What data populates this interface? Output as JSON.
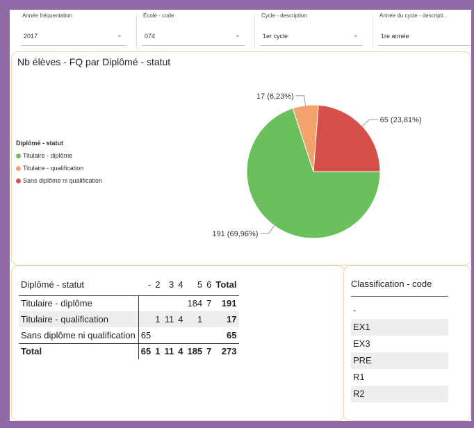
{
  "filters": [
    {
      "label": "Année fréquentation",
      "value": "2017"
    },
    {
      "label": "École - code",
      "value": "074"
    },
    {
      "label": "Cycle - description",
      "value": "1er cycle"
    },
    {
      "label": "Année du cycle - descripti...",
      "value": "1re année"
    }
  ],
  "chart": {
    "title": "Nb élèves - FQ par Diplômé - statut",
    "legend_title": "Diplômé - statut",
    "legend": [
      {
        "label": "Titulaire - diplôme",
        "color": "#6bbf5c"
      },
      {
        "label": "Titulaire - qualification",
        "color": "#f2a26b"
      },
      {
        "label": "Sans diplôme ni qualification",
        "color": "#d6504a"
      }
    ]
  },
  "chart_data": {
    "type": "pie",
    "title": "Nb élèves - FQ par Diplômé - statut",
    "legend_title": "Diplômé - statut",
    "legend_placement": "left",
    "slices": [
      {
        "label": "Titulaire - diplôme",
        "value": 191,
        "data_label": "191 (69,96%)",
        "color": "#6bbf5c"
      },
      {
        "label": "Titulaire - qualification",
        "value": 17,
        "data_label": "17 (6,23%)",
        "color": "#f2a26b"
      },
      {
        "label": "Sans diplôme ni qualification",
        "value": 65,
        "data_label": "65 (23,81%)",
        "color": "#d6504a"
      }
    ]
  },
  "matrix": {
    "row_header": "Diplômé - statut",
    "columns": [
      "-",
      "2",
      "3",
      "4",
      "5",
      "6",
      "Total"
    ],
    "rows": [
      {
        "label": "Titulaire - diplôme",
        "cells": [
          "",
          "",
          "",
          "",
          "184",
          "7",
          "191"
        ]
      },
      {
        "label": "Titulaire - qualification",
        "cells": [
          "",
          "1",
          "11",
          "4",
          "1",
          "",
          "17"
        ]
      },
      {
        "label": "Sans diplôme ni qualification",
        "cells": [
          "65",
          "",
          "",
          "",
          "",
          "",
          "65"
        ]
      }
    ],
    "total_row": {
      "label": "Total",
      "cells": [
        "65",
        "1",
        "11",
        "4",
        "185",
        "7",
        "273"
      ]
    }
  },
  "classification": {
    "header": "Classification - code",
    "items": [
      "-",
      "EX1",
      "EX3",
      "PRE",
      "R1",
      "R2"
    ]
  }
}
